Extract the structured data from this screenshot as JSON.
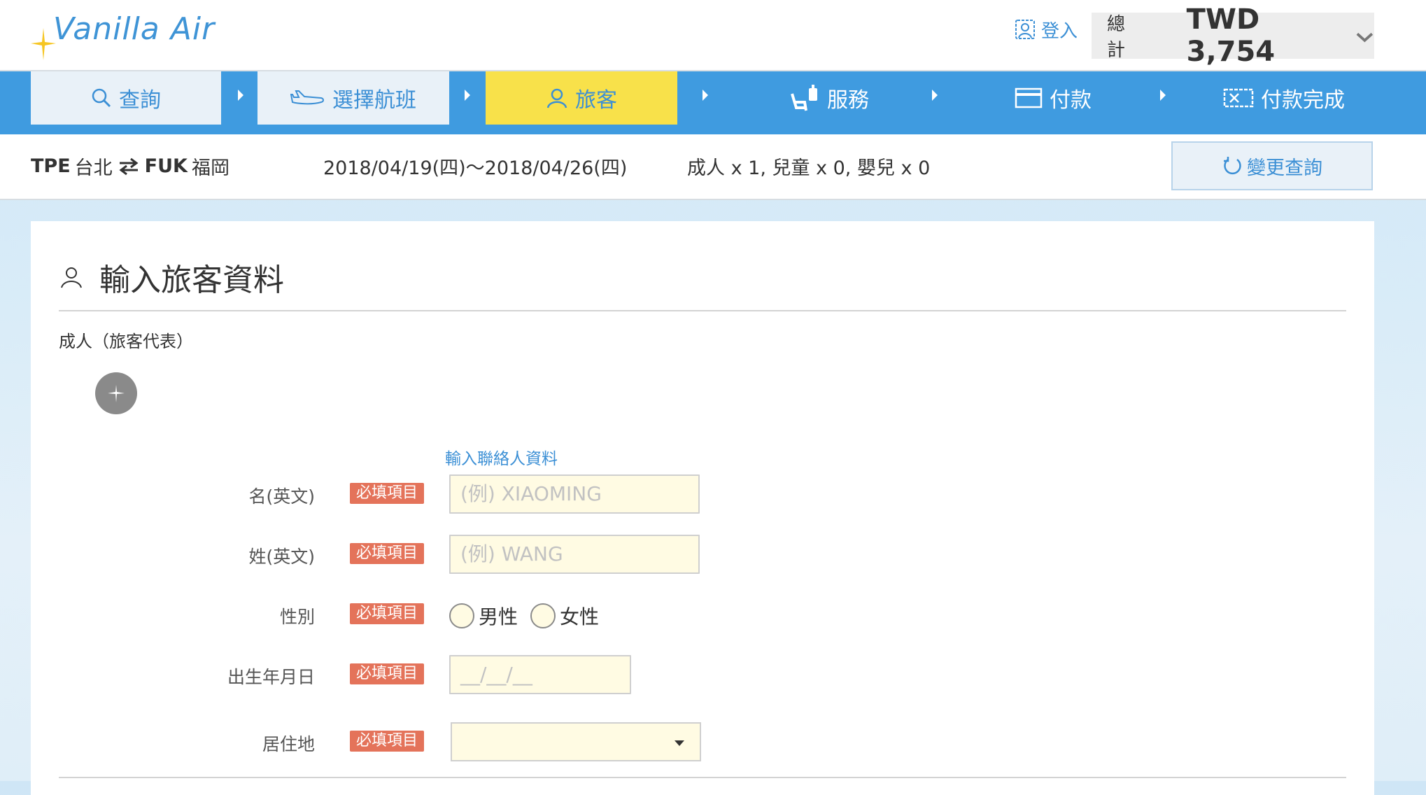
{
  "brand": {
    "name": "Vanilla Air",
    "primary_color": "#3f9be0",
    "accent_color": "#f8e14a"
  },
  "header": {
    "login_label": "登入",
    "total_label": "總計",
    "total_amount": "TWD 3,754"
  },
  "steps": [
    {
      "label": "查詢",
      "icon": "search-icon",
      "state": "done"
    },
    {
      "label": "選擇航班",
      "icon": "airplane-icon",
      "state": "done"
    },
    {
      "label": "旅客",
      "icon": "person-icon",
      "state": "current"
    },
    {
      "label": "服務",
      "icon": "seat-luggage-icon",
      "state": "pending"
    },
    {
      "label": "付款",
      "icon": "card-icon",
      "state": "pending"
    },
    {
      "label": "付款完成",
      "icon": "ticket-icon",
      "state": "pending"
    }
  ],
  "search_summary": {
    "origin_code": "TPE",
    "origin_city": "台北",
    "destination_code": "FUK",
    "destination_city": "福岡",
    "dates": "2018/04/19(四)〜2018/04/26(四)",
    "passengers": "成人 x 1,  兒童 x 0,  嬰兒 x 0",
    "change_button": "變更查詢"
  },
  "form": {
    "title": "輸入旅客資料",
    "section_label": "成人（旅客代表）",
    "contact_link": "輸入聯絡人資料",
    "required_badge": "必填項目",
    "fields": {
      "first_name": {
        "label": "名(英文)",
        "placeholder": "(例) XIAOMING",
        "value": ""
      },
      "last_name": {
        "label": "姓(英文)",
        "placeholder": "(例) WANG",
        "value": ""
      },
      "gender": {
        "label": "性別",
        "options": [
          "男性",
          "女性"
        ],
        "selected": null
      },
      "birthdate": {
        "label": "出生年月日",
        "placeholder": "__/__/__",
        "value": ""
      },
      "residence": {
        "label": "居住地",
        "selected": ""
      }
    }
  }
}
